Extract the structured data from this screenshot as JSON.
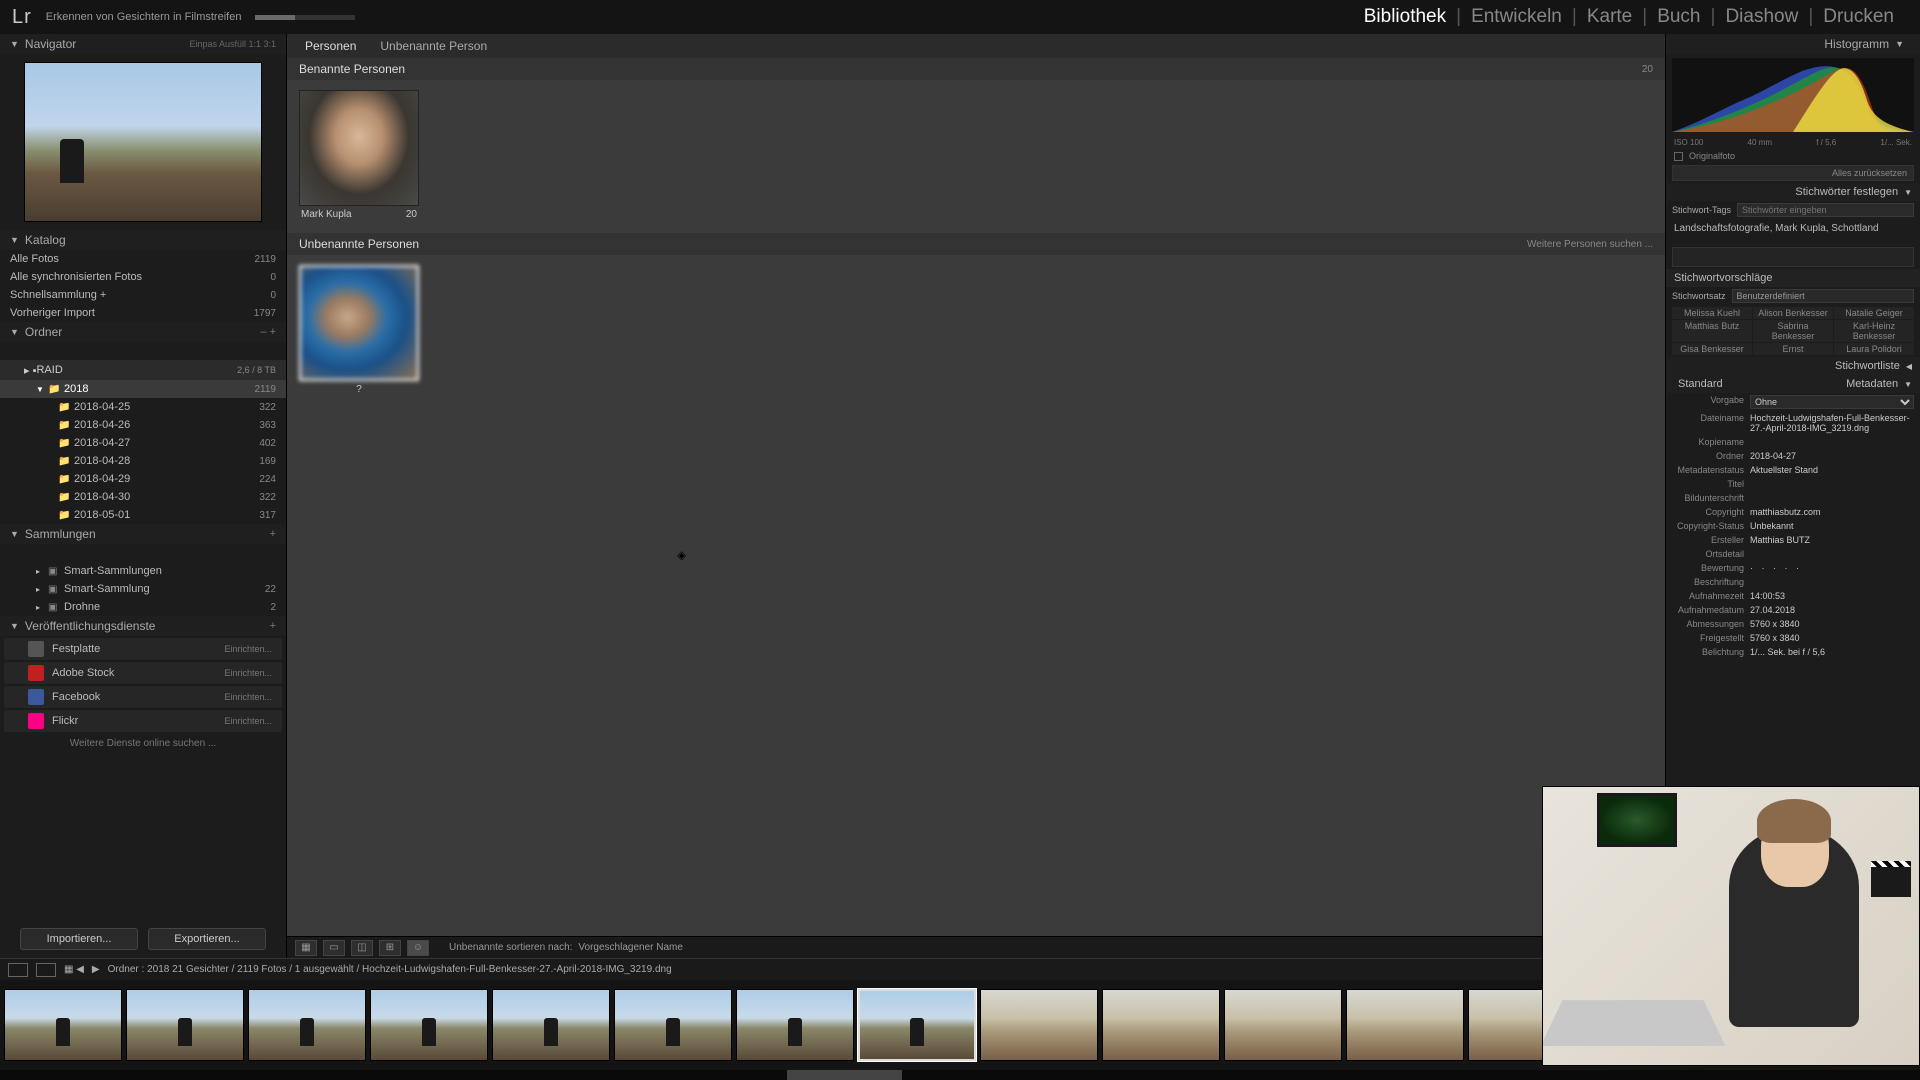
{
  "topbar": {
    "logo": "Lr",
    "task": "Erkennen von Gesichtern in Filmstreifen",
    "modules": [
      "Bibliothek",
      "Entwickeln",
      "Karte",
      "Buch",
      "Diashow",
      "Drucken"
    ],
    "active_module": 0
  },
  "left": {
    "navigator": {
      "title": "Navigator",
      "modes": "Einpas   Ausfüll   1:1   3:1"
    },
    "catalog": {
      "title": "Katalog",
      "items": [
        {
          "label": "Alle Fotos",
          "count": "2119"
        },
        {
          "label": "Alle synchronisierten Fotos",
          "count": "0"
        },
        {
          "label": "Schnellsammlung  +",
          "count": "0"
        },
        {
          "label": "Vorheriger Import",
          "count": "1797"
        }
      ]
    },
    "folders": {
      "title": "Ordner",
      "raid": {
        "label": "RAID",
        "info": "2,6 / 8 TB"
      },
      "year": {
        "label": "2018",
        "count": "2119"
      },
      "dates": [
        {
          "label": "2018-04-25",
          "count": "322"
        },
        {
          "label": "2018-04-26",
          "count": "363"
        },
        {
          "label": "2018-04-27",
          "count": "402"
        },
        {
          "label": "2018-04-28",
          "count": "169"
        },
        {
          "label": "2018-04-29",
          "count": "224"
        },
        {
          "label": "2018-04-30",
          "count": "322"
        },
        {
          "label": "2018-05-01",
          "count": "317"
        }
      ]
    },
    "collections": {
      "title": "Sammlungen",
      "items": [
        {
          "label": "Smart-Sammlungen",
          "count": ""
        },
        {
          "label": "Smart-Sammlung",
          "count": "22"
        },
        {
          "label": "Drohne",
          "count": "2"
        }
      ]
    },
    "publish": {
      "title": "Veröffentlichungsdienste",
      "items": [
        {
          "label": "Festplatte",
          "color": "#555",
          "conf": "Einrichten..."
        },
        {
          "label": "Adobe Stock",
          "color": "#c02020",
          "conf": "Einrichten..."
        },
        {
          "label": "Facebook",
          "color": "#3b5998",
          "conf": "Einrichten..."
        },
        {
          "label": "Flickr",
          "color": "#ff0084",
          "conf": "Einrichten..."
        }
      ],
      "more": "Weitere Dienste online suchen ..."
    },
    "import_btn": "Importieren...",
    "export_btn": "Exportieren..."
  },
  "center": {
    "breadcrumb": [
      "Personen",
      "Unbenannte Person"
    ],
    "named": {
      "title": "Benannte Personen",
      "count": "20",
      "person": {
        "name": "Mark Kupla",
        "count": "20"
      }
    },
    "unnamed": {
      "title": "Unbenannte Personen",
      "search": "Weitere Personen suchen ...",
      "count": "?"
    },
    "toolbar": {
      "sort_label": "Unbenannte sortieren nach:",
      "sort_value": "Vorgeschlagener Name"
    }
  },
  "filmstrip": {
    "path": "Ordner : 2018   21 Gesichter / 2119 Fotos / 1 ausgewählt / Hochzeit-Ludwigshafen-Full-Benkesser-27.-April-2018-IMG_3219.dng",
    "selected_index": 7
  },
  "right": {
    "histogram": {
      "iso": "ISO 100",
      "focal": "40 mm",
      "aperture": "f / 5,6",
      "shutter": "1/... Sek."
    },
    "original": "Originalfoto",
    "reset": "Alles zurücksetzen",
    "keywords": {
      "title": "Stichwörter festlegen",
      "tags_label": "Stichwort-Tags",
      "tags_placeholder": "Stichwörter eingeben",
      "body": "Landschaftsfotografie, Mark Kupla, Schottland"
    },
    "suggestions": {
      "title": "Stichwortvorschläge",
      "set_label": "Stichwortsatz",
      "set_value": "Benutzerdefiniert",
      "grid": [
        "Melissa Kuehl",
        "Alison Benkesser",
        "Natalie Geiger",
        "Matthias Butz",
        "Sabrina Benkesser",
        "Karl-Heinz Benkesser",
        "Gisa Benkesser",
        "Ernst",
        "Laura Polidori"
      ]
    },
    "keyword_list": {
      "title": "Stichwortliste"
    },
    "metadata": {
      "title": "Metadaten",
      "preset_label": "Standard",
      "rows": [
        {
          "label": "Vorgabe",
          "value": "Ohne",
          "dropdown": true
        },
        {
          "label": "Dateiname",
          "value": "Hochzeit-Ludwigshafen-Full-Benkesser-27.-April-2018-IMG_3219.dng"
        },
        {
          "label": "Kopiename",
          "value": ""
        },
        {
          "label": "Ordner",
          "value": "2018-04-27"
        },
        {
          "label": "Metadatenstatus",
          "value": "Aktuellster Stand"
        },
        {
          "label": "Titel",
          "value": ""
        },
        {
          "label": "Bildunterschrift",
          "value": ""
        },
        {
          "label": "Copyright",
          "value": "matthiasbutz.com"
        },
        {
          "label": "Copyright-Status",
          "value": "Unbekannt"
        },
        {
          "label": "Ersteller",
          "value": "Matthias BUTZ"
        },
        {
          "label": "Ortsdetail",
          "value": ""
        },
        {
          "label": "Bewertung",
          "value": "·  ·  ·  ·  ·",
          "stars": true
        },
        {
          "label": "Beschriftung",
          "value": ""
        },
        {
          "label": "Aufnahmezeit",
          "value": "14:00:53"
        },
        {
          "label": "Aufnahmedatum",
          "value": "27.04.2018"
        },
        {
          "label": "Abmessungen",
          "value": "5760 x 3840"
        },
        {
          "label": "Freigestellt",
          "value": "5760 x 3840"
        },
        {
          "label": "Belichtung",
          "value": "1/... Sek. bei f / 5,6"
        }
      ]
    }
  }
}
